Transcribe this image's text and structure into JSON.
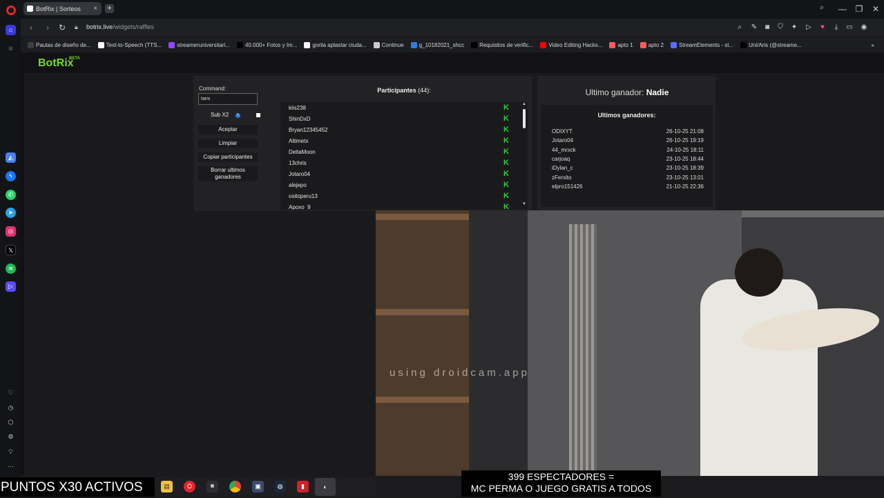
{
  "browser": {
    "tab_title": "BotRix | Sorteos",
    "tab_close": "×",
    "new_tab": "+",
    "url_host": "botrix.live",
    "url_path": "/widgets/raffles",
    "window": {
      "minimize": "—",
      "maximize": "❐",
      "close": "✕"
    },
    "bookmarks": [
      {
        "label": "Pautas de diseño de...",
        "color": "#3d3d42"
      },
      {
        "label": "Text-to-Speech (TTS...",
        "color": "#ffffff"
      },
      {
        "label": "streameruniversitari...",
        "color": "#9146ff"
      },
      {
        "label": "40.000+ Fotos y Im...",
        "color": "#000000"
      },
      {
        "label": "gorila aplastar ciuda...",
        "color": "#ffffff"
      },
      {
        "label": "Continue",
        "color": "#cccccc"
      },
      {
        "label": "g_10182021_shcc",
        "color": "#2a7de1"
      },
      {
        "label": "Requisitos de verific...",
        "color": "#000000"
      },
      {
        "label": "Video Editing Hacks...",
        "color": "#ff0000"
      },
      {
        "label": "apto 1",
        "color": "#ff5a5f"
      },
      {
        "label": "apto 2",
        "color": "#ff5a5f"
      },
      {
        "label": "StreamElements - st...",
        "color": "#5a6bff"
      },
      {
        "label": "Uni/Aris (@streame...",
        "color": "#000000"
      }
    ],
    "bookmarks_more": "»"
  },
  "sidebar": {
    "icons": [
      "home-icon",
      "star-icon",
      "maps-icon",
      "messenger-icon",
      "whatsapp-icon",
      "telegram-icon",
      "instagram-icon",
      "x-icon",
      "spotify-icon",
      "player-icon"
    ],
    "bottom_icons": [
      "heart-icon",
      "history-icon",
      "cube-icon",
      "settings-icon",
      "bulb-icon",
      "more-icon"
    ]
  },
  "botrix": {
    "logo": "BotRix",
    "beta": "BETA"
  },
  "raffle": {
    "command_label": "Command:",
    "command_value": "taris",
    "sub_label": "Sub X2",
    "accept": "Aceptar",
    "clear": "Limpiar",
    "copy": "Copiar participantes",
    "delete_line1": "Borrar ultimos",
    "delete_line2": "ganadores",
    "participants_title": "Participantes",
    "participants_count": "(44):",
    "participants": [
      "kiis238",
      "ShinDxD",
      "Bryan12345452",
      "Altimetx",
      "DeltaMoon",
      "13chris",
      "Jotaro04",
      "alejepo",
      "ositoperu13",
      "Apoxo_9"
    ],
    "kick_badge": "K"
  },
  "winners": {
    "last_label": "Ultimo ganador:",
    "last_value": "Nadie",
    "title": "Ultimos ganadores:",
    "rows": [
      {
        "name": "ODIXYT",
        "date": "26-10-25 21:08"
      },
      {
        "name": "Jotaro04",
        "date": "26-10-25 19:19"
      },
      {
        "name": "44_mrxck",
        "date": "24-10-25 18:11"
      },
      {
        "name": "carjoaq",
        "date": "23-10-25 18:44"
      },
      {
        "name": "iDylan_c",
        "date": "23-10-25 18:39"
      },
      {
        "name": "zFerxito",
        "date": "23-10-25 13:01"
      },
      {
        "name": "elpro151426",
        "date": "21-10-25 22:36"
      }
    ]
  },
  "stream": {
    "watermark": "using droidcam.app",
    "overlay_line1": "399 ESPECTADORES =",
    "overlay_line2": "MC PERMA O JUEGO GRATIS A TODOS",
    "puntos": "PUNTOS X30 ACTIVOS"
  },
  "taskbar": [
    "files-icon",
    "opera-icon",
    "game-icon",
    "chrome-icon",
    "app-icon",
    "steam-icon",
    "media-icon",
    "obs-icon"
  ]
}
